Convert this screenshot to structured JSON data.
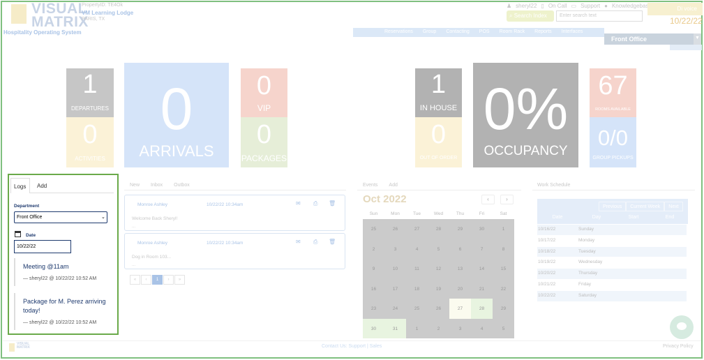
{
  "header": {
    "logo_top": "VISUAL",
    "logo_bottom": "MATRIX",
    "system_name": "Hospitality Operating System",
    "property_id": "PropertyID: TE4Ok",
    "property_name": "VM Learning Lodge",
    "property_city": "PARIS, TX",
    "user": "sheryl22",
    "on_call": "On Call",
    "support": "Support",
    "knowledgebase": "Knowledgebase",
    "search_button": "Search Index",
    "search_placeholder": "Enter search text",
    "user_tab": "Di voice",
    "date": "10/22/22",
    "nav": [
      "Reservations",
      "Group",
      "Contacting",
      "POS",
      "Room Rack",
      "Reports",
      "Interfaces"
    ],
    "department_tab": "Front Office"
  },
  "stats_left": {
    "departures": {
      "value": "1",
      "label": "DEPARTURES"
    },
    "activities": {
      "value": "0",
      "label": "ACTIVITIES"
    },
    "arrivals": {
      "value": "0",
      "label": "ARRIVALS"
    },
    "vip": {
      "value": "0",
      "label": "VIP"
    },
    "packages": {
      "value": "0",
      "label": "PACKAGES"
    }
  },
  "stats_right": {
    "in_house": {
      "value": "1",
      "label": "IN HOUSE"
    },
    "out_of_order": {
      "value": "0",
      "label": "OUT OF ORDER"
    },
    "occupancy": {
      "value": "0%",
      "label": "OCCUPANCY"
    },
    "rooms_available": {
      "value": "67",
      "label": "ROOMS AVAILABLE"
    },
    "group_pickups": {
      "value": "0/0",
      "label": "GROUP PICKUPS"
    }
  },
  "logs": {
    "tab_logs": "Logs",
    "tab_add": "Add",
    "department_label": "Department",
    "department_value": "Front Office",
    "date_label": "Date",
    "date_value": "10/22/22",
    "entries": [
      {
        "title": "Meeting @11am",
        "meta": "— sheryl22 @ 10/22/22 10:52 AM"
      },
      {
        "title": "Package for M. Perez arriving today!",
        "meta": "— sheryl22 @ 10/22/22 10:52 AM"
      }
    ]
  },
  "messages": {
    "tabs": [
      "New",
      "Inbox",
      "Outbox"
    ],
    "items": [
      {
        "from": "Monroe Ashley",
        "time": "10/22/22 10:34am",
        "body": "Welcome Back Sheryl!",
        "dots": "..."
      },
      {
        "from": "Monroe Ashley",
        "time": "10/22/22 10:34am",
        "body": "Dog in Room 103...",
        "dots": "..."
      }
    ],
    "pager": [
      "«",
      "‹",
      "1",
      "›",
      "»"
    ]
  },
  "events": {
    "tabs": [
      "Events",
      "Add"
    ],
    "month": "Oct 2022",
    "prev": "‹",
    "next": "›",
    "weekdays": [
      "Sun",
      "Mon",
      "Tue",
      "Wed",
      "Thu",
      "Fri",
      "Sat"
    ],
    "days": [
      "25",
      "26",
      "27",
      "28",
      "29",
      "30",
      "1",
      "2",
      "3",
      "4",
      "5",
      "6",
      "7",
      "8",
      "9",
      "10",
      "11",
      "12",
      "13",
      "14",
      "15",
      "16",
      "17",
      "18",
      "19",
      "20",
      "21",
      "22",
      "23",
      "24",
      "25",
      "26",
      "27",
      "28",
      "29",
      "30",
      "31",
      "1",
      "2",
      "3",
      "4",
      "5"
    ]
  },
  "schedule": {
    "tab": "Work Schedule",
    "buttons": [
      "Previous",
      "Current Week",
      "Next"
    ],
    "headers": [
      "Date",
      "Day",
      "Start",
      "End"
    ],
    "rows": [
      {
        "date": "10/16/22",
        "day": "Sunday"
      },
      {
        "date": "10/17/22",
        "day": "Monday"
      },
      {
        "date": "10/18/22",
        "day": "Tuesday"
      },
      {
        "date": "10/19/22",
        "day": "Wednesday"
      },
      {
        "date": "10/20/22",
        "day": "Thursday"
      },
      {
        "date": "10/21/22",
        "day": "Friday"
      },
      {
        "date": "10/22/22",
        "day": "Saturday"
      }
    ]
  },
  "footer": {
    "logo_top": "VISUAL",
    "logo_bottom": "MATRIX",
    "center": "Contact Us: Support | Sales",
    "right": "Privacy Policy"
  }
}
